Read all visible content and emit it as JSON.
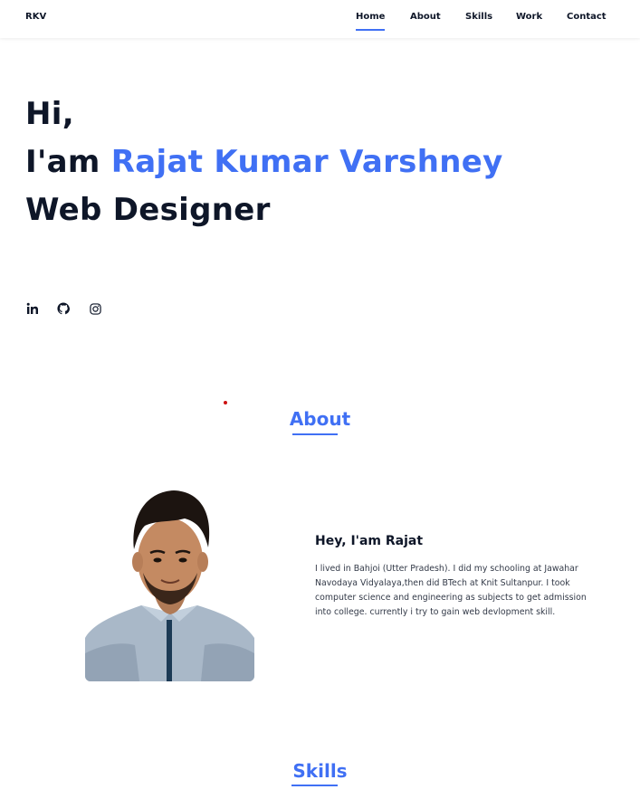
{
  "header": {
    "logo": "RKV",
    "nav": [
      {
        "label": "Home",
        "active": true
      },
      {
        "label": "About",
        "active": false
      },
      {
        "label": "Skills",
        "active": false
      },
      {
        "label": "Work",
        "active": false
      },
      {
        "label": "Contact",
        "active": false
      }
    ]
  },
  "hero": {
    "line1": "Hi,",
    "line2_prefix": "I'am ",
    "name": "Rajat Kumar Varshney",
    "line3": "Web Designer"
  },
  "socials": [
    {
      "icon": "linkedin-icon"
    },
    {
      "icon": "github-icon"
    },
    {
      "icon": "instagram-icon"
    }
  ],
  "about": {
    "title": "About",
    "subtitle": "Hey, I'am Rajat",
    "text": "I lived in Bahjoi (Utter Pradesh). I did my schooling at Jawahar Navodaya Vidyalaya,then did BTech at Knit Sultanpur. I took computer science and engineering as subjects to get admission into college. currently i try to gain web devlopment skill.",
    "photo_alt": "profile-photo"
  },
  "skills": {
    "title": "Skills"
  },
  "colors": {
    "accent": "#4070f4",
    "text": "#0e1628"
  }
}
